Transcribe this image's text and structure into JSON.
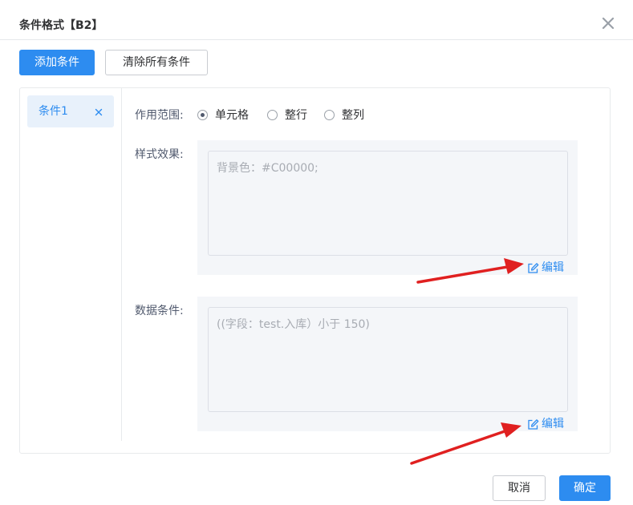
{
  "dialog": {
    "title": "条件格式【B2】",
    "close_icon": "close-icon"
  },
  "toolbar": {
    "add_condition_label": "添加条件",
    "clear_all_label": "清除所有条件"
  },
  "conditions": [
    {
      "label": "条件1",
      "selected": true,
      "remove_icon": "close-icon"
    }
  ],
  "scope": {
    "label": "作用范围:",
    "options": [
      {
        "label": "单元格",
        "checked": true
      },
      {
        "label": "整行",
        "checked": false
      },
      {
        "label": "整列",
        "checked": false
      }
    ]
  },
  "style_effect": {
    "label": "样式效果:",
    "value": "背景色：#C00000;",
    "edit_label": "编辑",
    "edit_icon": "edit-icon"
  },
  "data_condition": {
    "label": "数据条件:",
    "value": "((字段：test.入库）小于 150)",
    "edit_label": "编辑",
    "edit_icon": "edit-icon"
  },
  "footer": {
    "cancel_label": "取消",
    "confirm_label": "确定"
  },
  "colors": {
    "primary": "#2d8cf0",
    "annotation_arrow": "#e02020",
    "block_background": "#f4f6f9"
  }
}
